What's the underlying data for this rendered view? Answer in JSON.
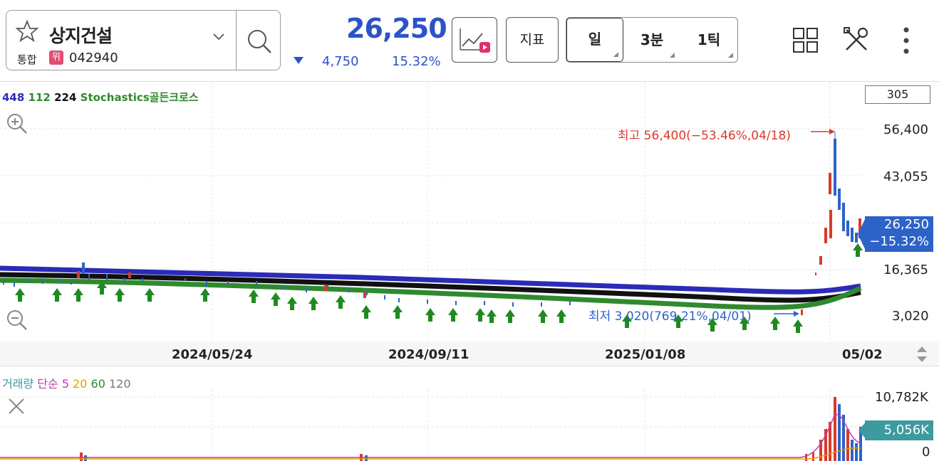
{
  "stock": {
    "name": "상지건설",
    "market": "통합",
    "warning_badge": "위",
    "code": "042940",
    "price": "26,250",
    "change": "4,750",
    "change_pct": "15.32%"
  },
  "toolbar": {
    "indicator_label": "지표",
    "periods": [
      "일",
      "3분",
      "1틱"
    ]
  },
  "main_chart": {
    "legend": {
      "p1": "448",
      "p2": "112",
      "p3": "224",
      "signal": "Stochastics골든크로스"
    },
    "bar_count": "305",
    "y_labels": [
      "56,400",
      "43,055",
      "16,365",
      "3,020"
    ],
    "current_price": "26,250",
    "current_pct": "−15.32%",
    "high_annotation": "최고 56,400(−53.46%,04/18)",
    "low_annotation": "최저 3,020(769.21%,04/01)",
    "dates": [
      "2024/05/24",
      "2024/09/11",
      "2025/01/08",
      "05/02"
    ]
  },
  "volume_chart": {
    "legend": {
      "label": "거래량",
      "type": "단순",
      "m1": "5",
      "m2": "20",
      "m3": "60",
      "m4": "120"
    },
    "y_labels": [
      "10,782K",
      "0"
    ],
    "current_volume": "5,056K"
  },
  "colors": {
    "price_blue": "#2d52c8",
    "ma_blue": "#2b2bb8",
    "ma_black": "#111111",
    "ma_green": "#2f8a2f",
    "candle_up": "#d93a2b",
    "candle_down": "#2d63c8",
    "signal_arrow": "#1f8a1f",
    "volume_tag": "#3d9a9e"
  }
}
